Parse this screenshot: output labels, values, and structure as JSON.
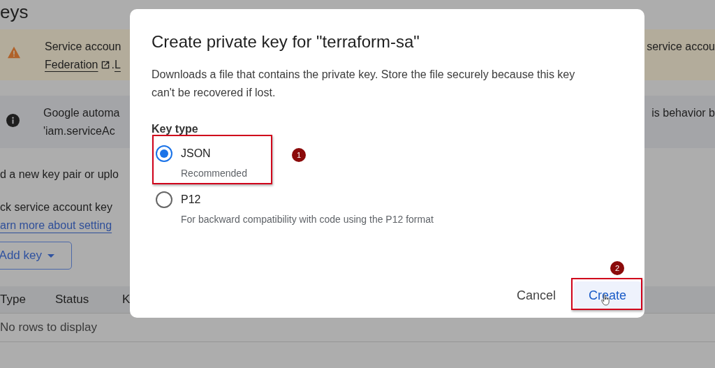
{
  "page": {
    "title": "eys",
    "warning_banner": {
      "line1": "Service accoun",
      "link": "Federation",
      "line2_rest": ". ",
      "link2": "L",
      "right_text": "service accou"
    },
    "info_banner": {
      "line1": "Google automa",
      "line2": "'iam.serviceAc",
      "right_text": "is behavior b"
    },
    "paragraphs": [
      "d a new key pair or uplo",
      "ck service account key"
    ],
    "link": "arn more about setting",
    "add_key_button": "Add key",
    "table": {
      "columns": [
        "Type",
        "Status",
        "K"
      ],
      "empty_message": "No rows to display"
    }
  },
  "dialog": {
    "title": "Create private key for \"terraform-sa\"",
    "description": "Downloads a file that contains the private key. Store the file securely because this key can't be recovered if lost.",
    "key_type_label": "Key type",
    "options": [
      {
        "label": "JSON",
        "hint": "Recommended",
        "selected": true
      },
      {
        "label": "P12",
        "hint": "For backward compatibility with code using the P12 format",
        "selected": false
      }
    ],
    "buttons": [
      {
        "label": "Cancel",
        "kind": "text"
      },
      {
        "label": "Create",
        "kind": "primary"
      }
    ]
  },
  "annotations": [
    {
      "number": "1"
    },
    {
      "number": "2"
    }
  ]
}
